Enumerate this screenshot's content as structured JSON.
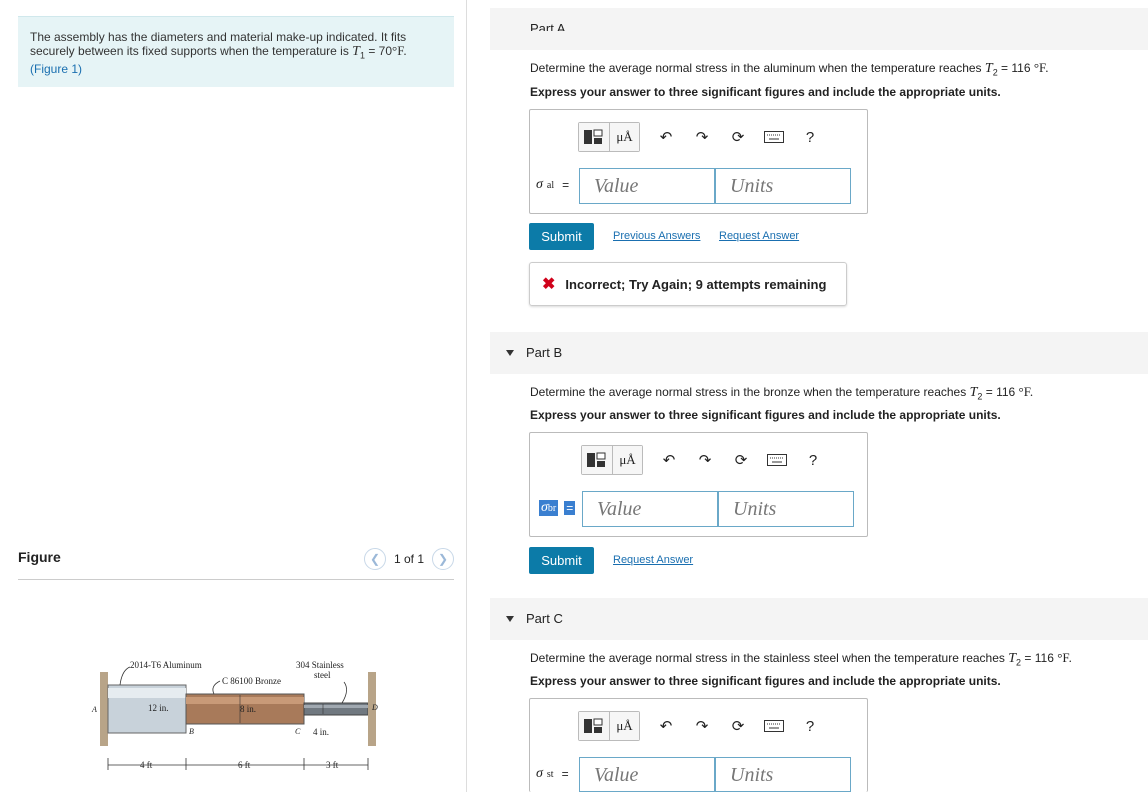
{
  "intro": {
    "line1": "The assembly has the diameters and material make-up indicated. It fits",
    "line2_prefix": "securely between its fixed supports when the temperature is ",
    "t1_symbol": "T",
    "t1_sub": "1",
    "t1_value": " = 70",
    "t1_unit": "°F.",
    "figure_link": "(Figure 1)"
  },
  "figure_panel": {
    "title": "Figure",
    "pager_text": "1 of 1",
    "prev_icon": "chevron-left-icon",
    "next_icon": "chevron-right-icon"
  },
  "figure": {
    "label_aluminum": "2014-T6 Aluminum",
    "label_bronze": "C 86100 Bronze",
    "label_steel_1": "304 Stainless",
    "label_steel_2": "steel",
    "d_aluminum": "12 in.",
    "d_bronze": "8 in.",
    "d_steel": "4 in.",
    "point_a": "A",
    "point_b": "B",
    "point_c": "C",
    "point_d": "D",
    "len_aluminum": "4 ft",
    "len_bronze": "6 ft",
    "len_steel": "3 ft"
  },
  "toolbar": {
    "mu_label": "μÅ",
    "icons": [
      "templates-icon",
      "units-icon",
      "undo-icon",
      "redo-icon",
      "reset-icon",
      "keyboard-icon",
      "help-icon"
    ],
    "help_label": "?"
  },
  "partA": {
    "header_cut": "Part A",
    "question_prefix": "Determine the average normal stress in the aluminum when the temperature reaches ",
    "t2_symbol": "T",
    "t2_sub": "2",
    "t2_value": " = 116 ",
    "t2_unit": "°F.",
    "instruction": "Express your answer to three significant figures and include the appropriate units.",
    "var_symbol": "σ",
    "var_sub": "al",
    "equals": "=",
    "value_placeholder": "Value",
    "units_placeholder": "Units",
    "submit_label": "Submit",
    "previous_answers_label": "Previous Answers",
    "request_answer_label": "Request Answer",
    "feedback_text": "Incorrect; Try Again; 9 attempts remaining"
  },
  "partB": {
    "header": "Part B",
    "question_prefix": "Determine the average normal stress in the bronze when the temperature reaches ",
    "t2_symbol": "T",
    "t2_sub": "2",
    "t2_value": " = 116 ",
    "t2_unit": "°F.",
    "instruction": "Express your answer to three significant figures and include the appropriate units.",
    "var_symbol": "σ",
    "var_sub": "br",
    "equals": "=",
    "value_placeholder": "Value",
    "units_placeholder": "Units",
    "submit_label": "Submit",
    "request_answer_label": "Request Answer"
  },
  "partC": {
    "header": "Part C",
    "question_prefix": "Determine the average normal stress in the stainless steel when the temperature reaches ",
    "t2_symbol": "T",
    "t2_sub": "2",
    "t2_value": " = 116 ",
    "t2_unit": "°F.",
    "instruction": "Express your answer to three significant figures and include the appropriate units.",
    "var_symbol": "σ",
    "var_sub": "st",
    "equals": "=",
    "value_placeholder": "Value",
    "units_placeholder": "Units"
  },
  "colors": {
    "intro_bg": "#e6f4f6",
    "submit_bg": "#0c7ba8",
    "link": "#1a6fb0",
    "error": "#d0021b",
    "field_border": "#6aa8c8"
  }
}
